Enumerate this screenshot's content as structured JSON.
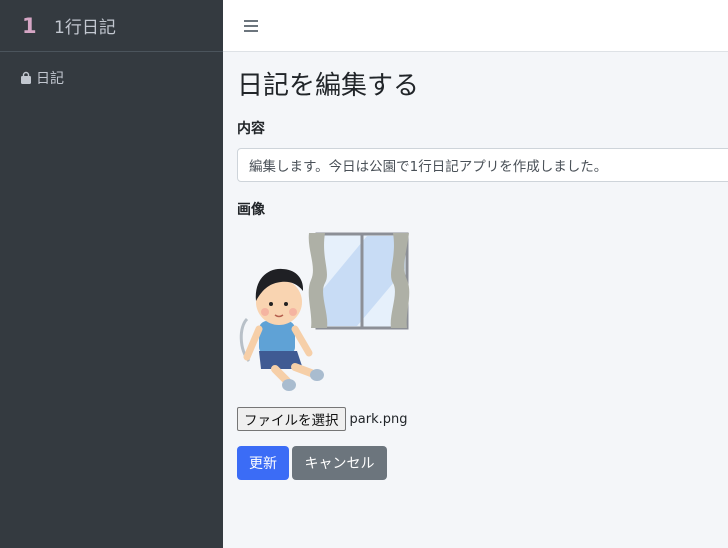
{
  "brand": {
    "logo": "1",
    "title": "1行日記"
  },
  "sidebar": {
    "items": [
      {
        "label": "日記",
        "icon": "bag-icon"
      }
    ]
  },
  "topbar": {
    "menu_icon": "hamburger-icon"
  },
  "page": {
    "title": "日記を編集する"
  },
  "form": {
    "content_label": "内容",
    "content_value": "編集します。今日は公園で1行日記アプリを作成しました。",
    "image_label": "画像",
    "image_alt": "boy sitting by window illustration",
    "file_button": "ファイルを選択",
    "file_name": "park.png",
    "submit_label": "更新",
    "cancel_label": "キャンセル"
  },
  "colors": {
    "sidebar_bg": "#343a40",
    "primary": "#3b6cf6",
    "secondary": "#6c757d",
    "page_bg": "#f4f6f9"
  }
}
